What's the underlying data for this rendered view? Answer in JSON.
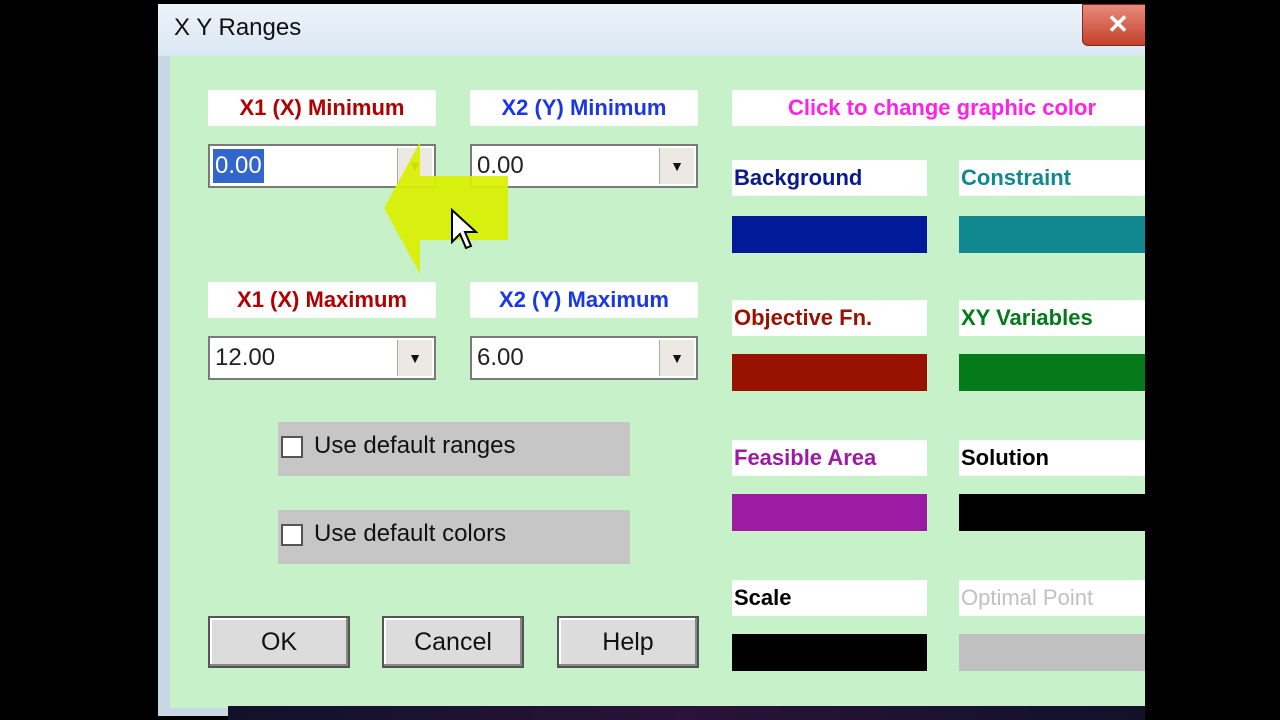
{
  "window": {
    "title": "X Y Ranges",
    "close_glyph": "✕"
  },
  "ranges": {
    "x1_min_label": "X1 (X) Minimum",
    "x1_min_value": "0.00",
    "x2_min_label": "X2 (Y) Minimum",
    "x2_min_value": "0.00",
    "x1_max_label": "X1 (X) Maximum",
    "x1_max_value": "12.00",
    "x2_max_label": "X2 (Y) Maximum",
    "x2_max_value": "6.00",
    "dropdown_glyph": "▼"
  },
  "checkboxes": {
    "default_ranges": "Use default ranges",
    "default_colors": "Use default colors"
  },
  "buttons": {
    "ok": "OK",
    "cancel": "Cancel",
    "help": "Help"
  },
  "colors": {
    "heading": "Click to change graphic color",
    "background": {
      "label": "Background",
      "color": "#001a99"
    },
    "constraint": {
      "label": "Constraint",
      "color": "#11878f"
    },
    "objective": {
      "label": "Objective Fn.",
      "color": "#991100"
    },
    "xy_variables": {
      "label": "XY Variables",
      "color": "#047a1a"
    },
    "feasible_area": {
      "label": "Feasible Area",
      "color": "#9b1ba3"
    },
    "solution": {
      "label": "Solution",
      "color": "#000000"
    },
    "scale": {
      "label": "Scale",
      "color": "#000000"
    },
    "optimal_point": {
      "label": "Optimal Point",
      "color": "#c0c0c0"
    }
  }
}
